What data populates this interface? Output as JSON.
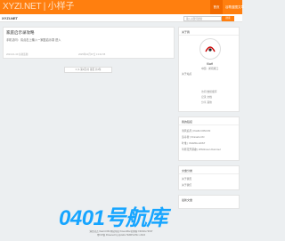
{
  "header": {
    "logo": "XYZI.NET | 小样子",
    "nav": [
      "首页",
      "谷歌蓝图文章"
    ],
    "domain": "XYZI.NET",
    "search_placeholder": "输入关键词搜索",
    "search_button": "搜索"
  },
  "post": {
    "title": "家庭启示录攻略",
    "excerpt": "手机访问：请点击上输入一家庭启示录 进入",
    "meta": "2024-01-30 谷歌蓝图",
    "date": "2025年01月07日 13:21:55"
  },
  "pager": "1 | 1 第1页/共 第页 共3条",
  "sidebar": {
    "profile_head": "关于我",
    "name": "Kiwif",
    "location": "中国 · 湖南湘江",
    "about": "关于站点",
    "stats": [
      "访问 数组顺序",
      "记录 文档",
      "分享 其他"
    ],
    "links_head": "我的链接",
    "links": [
      "清风追月 | Kiwi9.COM.CN",
      "追寻者 | Finnaris.CN",
      "叶维 | XIUMIG.HOST",
      "草原花开茶歌 | Whirlmoon Kommel"
    ],
    "archive_head": "文章分类",
    "archive": [
      "关于我页",
      "关于我们"
    ],
    "recent_head": "最新文章"
  },
  "watermark": "0401号航库",
  "footer": {
    "line1": "满足站点 Xiaol.COM 网站导航 PowerMisc的博客 XIUMIG.HOST",
    "line2": "粤ICP备 Powered by jcjxiahu TEMPLATE v 2024"
  }
}
